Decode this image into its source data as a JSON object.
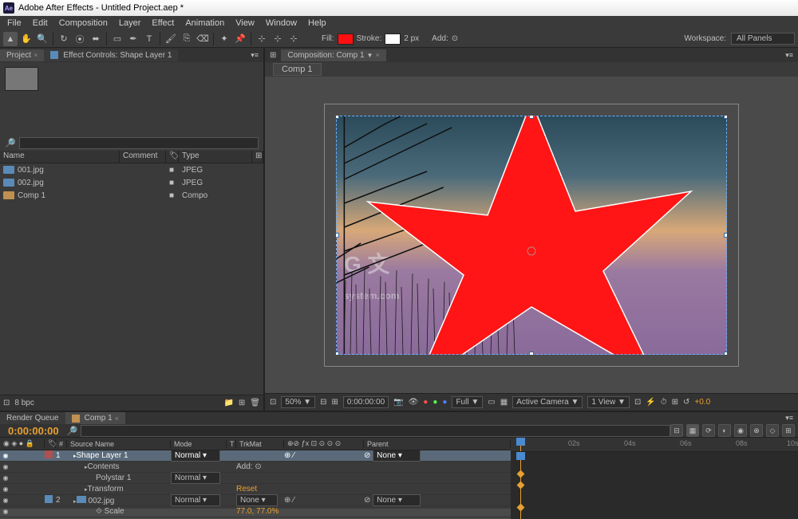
{
  "titlebar": {
    "app": "Adobe After Effects",
    "project": "Untitled Project.aep *",
    "logo": "Ae"
  },
  "menu": [
    "File",
    "Edit",
    "Composition",
    "Layer",
    "Effect",
    "Animation",
    "View",
    "Window",
    "Help"
  ],
  "toolbar": {
    "fill_label": "Fill:",
    "fill_color": "#ff1010",
    "stroke_label": "Stroke:",
    "stroke_px": "2 px",
    "add_label": "Add:",
    "workspace_label": "Workspace:",
    "workspace_value": "All Panels"
  },
  "panels": {
    "project_tab": "Project",
    "effect_tab": "Effect Controls: Shape Layer 1",
    "search_placeholder": "",
    "columns": {
      "name": "Name",
      "comment": "Comment",
      "type": "Type"
    },
    "items": [
      {
        "name": "001.jpg",
        "type": "JPEG",
        "icon": "img"
      },
      {
        "name": "002.jpg",
        "type": "JPEG",
        "icon": "img"
      },
      {
        "name": "Comp 1",
        "type": "Compo",
        "icon": "comp"
      }
    ],
    "footer_bpc": "8 bpc"
  },
  "comp": {
    "tab_label": "Composition: Comp 1",
    "subtab": "Comp 1",
    "zoom": "50%",
    "timecode": "0:00:00:00",
    "resolution": "Full",
    "camera": "Active Camera",
    "views": "1 View",
    "exposure": "+0.0"
  },
  "timeline": {
    "render_tab": "Render Queue",
    "comp_tab": "Comp 1",
    "current_time": "0:00:00:00",
    "cols": {
      "num": "#",
      "src": "Source Name",
      "mode": "Mode",
      "trk": "TrkMat",
      "parent": "Parent"
    },
    "layers": [
      {
        "num": "1",
        "name": "Shape Layer 1",
        "mode": "Normal",
        "trk": "",
        "parent": "None",
        "sel": true,
        "color": "#b05050",
        "indent": 0
      },
      {
        "num": "",
        "name": "Contents",
        "mode": "",
        "trk": "",
        "parent": "",
        "add": "Add:",
        "indent": 1
      },
      {
        "num": "",
        "name": "Polystar 1",
        "mode": "Normal",
        "trk": "",
        "parent": "",
        "indent": 2
      },
      {
        "num": "",
        "name": "Transform",
        "mode": "",
        "trk": "Reset",
        "parent": "",
        "indent": 1,
        "orange": true
      },
      {
        "num": "2",
        "name": "002.jpg",
        "mode": "Normal",
        "trk": "None",
        "parent": "None",
        "color": "#5a8ab8",
        "indent": 0,
        "icon": true
      },
      {
        "num": "",
        "name": "Scale",
        "mode": "",
        "trk": "77.0, 77.0%",
        "parent": "",
        "indent": 2,
        "orange": true,
        "link": true
      }
    ],
    "ruler": [
      "02s",
      "04s",
      "06s",
      "08s",
      "10s"
    ]
  }
}
